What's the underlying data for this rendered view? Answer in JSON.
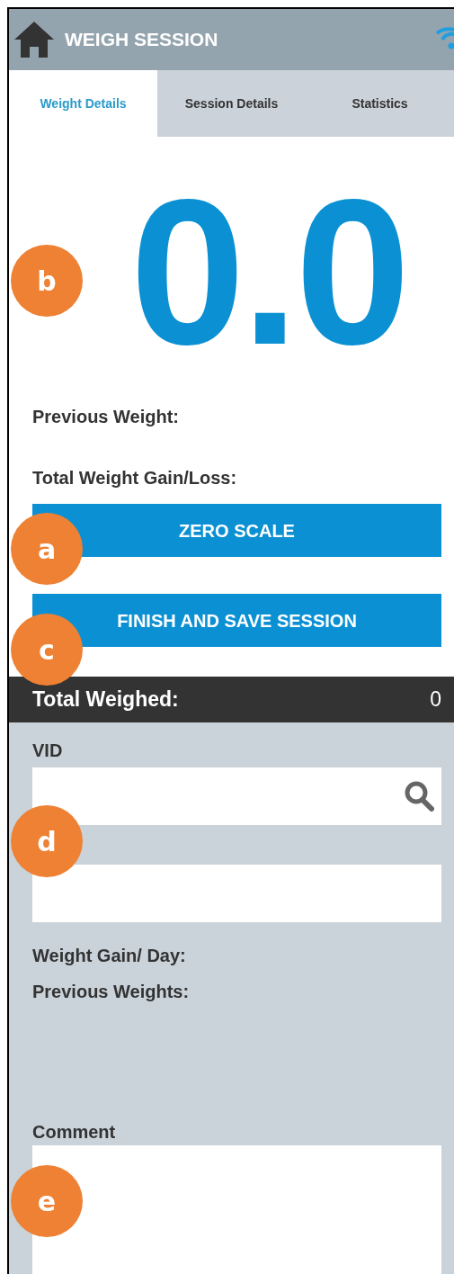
{
  "header": {
    "title": "WEIGH SESSION"
  },
  "tabs": [
    {
      "label": "Weight Details",
      "selected": true
    },
    {
      "label": "Session Details",
      "selected": false
    },
    {
      "label": "Statistics",
      "selected": false
    }
  ],
  "weight_display": "0.0",
  "summary": [
    "Previous Weight:",
    "Total Weight Gain/Loss:"
  ],
  "buttons": [
    "ZERO SCALE",
    "FINISH AND SAVE SESSION"
  ],
  "total_bar": {
    "label": "Total Weighed:",
    "value": "0"
  },
  "vid": {
    "label": "VID"
  },
  "details": [
    "Weight Gain/ Day:",
    "Previous Weights:"
  ],
  "comment": {
    "label": "Comment"
  },
  "callouts": [
    {
      "letter": "b"
    },
    {
      "letter": "a"
    },
    {
      "letter": "c"
    },
    {
      "letter": "d"
    },
    {
      "letter": "e"
    }
  ]
}
